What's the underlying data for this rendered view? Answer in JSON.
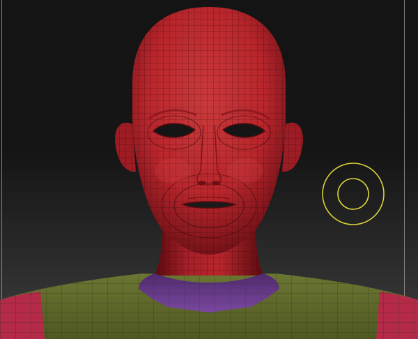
{
  "app": {
    "canvas_label": "",
    "colors": {
      "background_top": "#141414",
      "background_bottom": "#3d3d3d",
      "head_skin": "#b8262c",
      "head_shadow": "#5e0c12",
      "mesh_wire": "#2a0508",
      "collar_polygroup": "#6a3a8e",
      "torso_polygroup": "#5f6a2c",
      "shoulder_polygroup": "#b52a48",
      "brush_cursor": "#d8d23a",
      "frame_line": "#9a9a9a"
    }
  },
  "brush_cursor": {
    "icon": "brush-cursor-icon",
    "outer_ring": "draw-size-ring",
    "inner_ring": "focal-shift-ring"
  },
  "model": {
    "icon": "head-sculpt-mesh",
    "polygroups": [
      "head",
      "collar",
      "torso",
      "shoulders"
    ]
  }
}
